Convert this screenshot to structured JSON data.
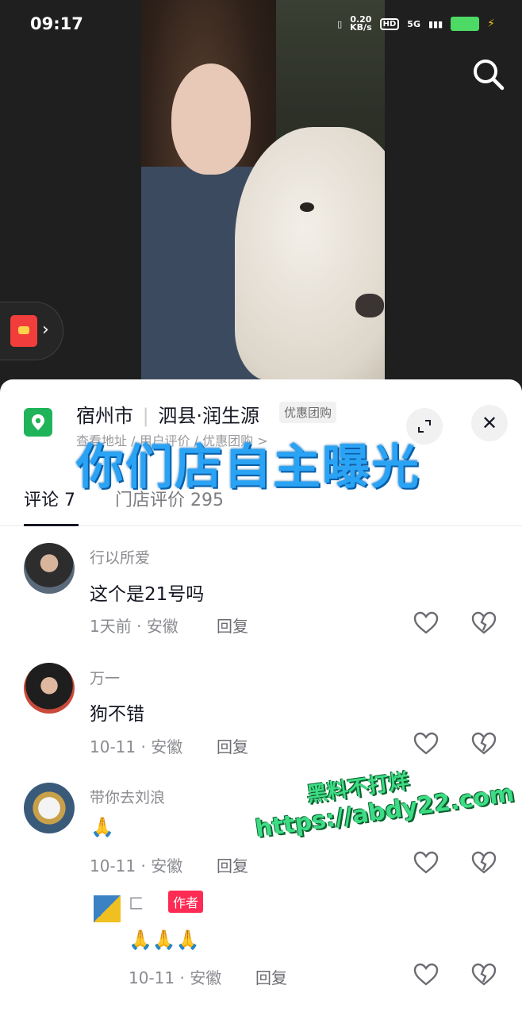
{
  "status_bar": {
    "time": "09:17",
    "net_speed": "0.20",
    "net_unit": "KB/s",
    "hd": "HD",
    "signal": "5G"
  },
  "icons": {
    "search": "search-icon",
    "redpacket": "red-packet-icon",
    "location": "location-pin-icon",
    "expand": "expand-icon",
    "close": "close-icon",
    "like": "heart-outline-icon",
    "dislike": "broken-heart-icon"
  },
  "shop": {
    "city": "宿州市",
    "name": "泗县·润生源",
    "tag": "优惠团购",
    "sub": "查看地址 / 用户评价 / 优惠团购 >"
  },
  "overlay_caption": "你们店自主曝光",
  "tabs": [
    {
      "label": "评论 7",
      "active": true
    },
    {
      "label": "门店评价 295",
      "active": false
    }
  ],
  "comments": [
    {
      "user": "行以所爱",
      "text": "这个是21号吗",
      "date": "1天前",
      "location": "安徽",
      "reply": "回复"
    },
    {
      "user": "万一",
      "text": "狗不错",
      "date": "10-11",
      "location": "安徽",
      "reply": "回复"
    },
    {
      "user": "带你去刘浪",
      "text": "",
      "emoji": "🙏",
      "date": "10-11",
      "location": "安徽",
      "reply": "回复"
    }
  ],
  "reply": {
    "user": "匚",
    "author_tag": "作者",
    "emoji": "🙏🙏🙏",
    "date": "10-11",
    "location": "安徽",
    "reply": "回复"
  },
  "watermark": {
    "line1": "黑料不打烊",
    "line2": "https://abdy22.com"
  },
  "colors": {
    "accent": "#fe2c55",
    "location_green": "#1fb35a",
    "overlay_blue": "#2aa3f5"
  }
}
